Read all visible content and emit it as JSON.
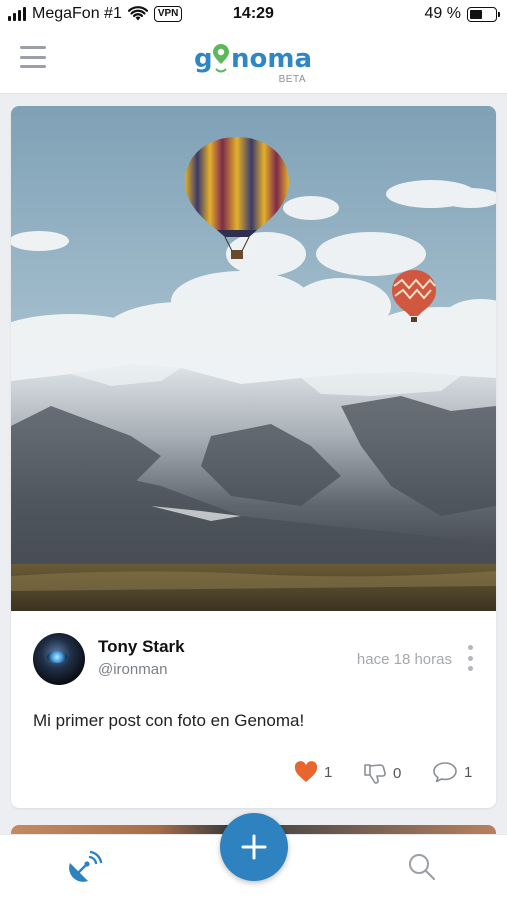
{
  "status_bar": {
    "carrier": "MegaFon #1",
    "vpn": "VPN",
    "time": "14:29",
    "battery_percent": "49 %",
    "battery_level": 0.49
  },
  "header": {
    "logo_text": "genoma",
    "beta_label": "BETA",
    "menu_icon": "hamburger-icon",
    "brand_color": "#2f86c7"
  },
  "post": {
    "image_description_icon": "photo",
    "author_name": "Tony Stark",
    "author_handle": "@ironman",
    "timestamp": "hace 18 horas",
    "text": "Mi primer post con foto en Genoma!",
    "likes": "1",
    "dislikes": "0",
    "comments": "1",
    "like_color": "#e8662e"
  },
  "bottom_nav": {
    "items": [
      {
        "icon": "satellite-feed-icon"
      },
      {
        "icon": "plus-icon"
      },
      {
        "icon": "search-icon"
      }
    ],
    "accent_color": "#2f82c0"
  }
}
